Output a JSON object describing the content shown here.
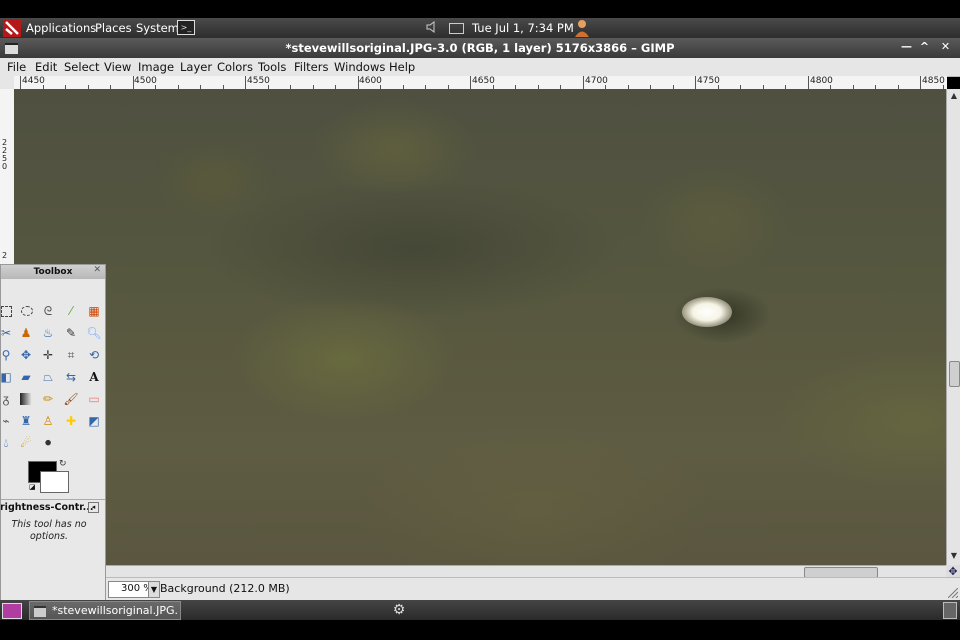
{
  "top_panel": {
    "menus": [
      "Applications",
      "Places",
      "System"
    ],
    "clock": "Tue Jul  1,  7:34 PM"
  },
  "window": {
    "title": "*stevewillsoriginal.JPG-3.0 (RGB, 1 layer) 5176x3866 – GIMP"
  },
  "menubar": {
    "items": [
      "File",
      "Edit",
      "Select",
      "View",
      "Image",
      "Layer",
      "Colors",
      "Tools",
      "Filters",
      "Windows",
      "Help"
    ]
  },
  "ruler": {
    "h_labels": [
      "4450",
      "4500",
      "4550",
      "4600",
      "4650",
      "4700",
      "4750",
      "4800",
      "4850"
    ],
    "v_label": "2250",
    "v_label2": "2"
  },
  "toolbox": {
    "title": "Toolbox",
    "tool_options_name": "rightness-Contr...",
    "no_options_text": "This tool has no options.",
    "fg_color": "#000000",
    "bg_color": "#ffffff"
  },
  "statusbar": {
    "zoom": "300 %",
    "layer_info": "Background (212.0 MB)"
  },
  "taskbar": {
    "task_label": "*stevewillsoriginal.JPG..."
  }
}
